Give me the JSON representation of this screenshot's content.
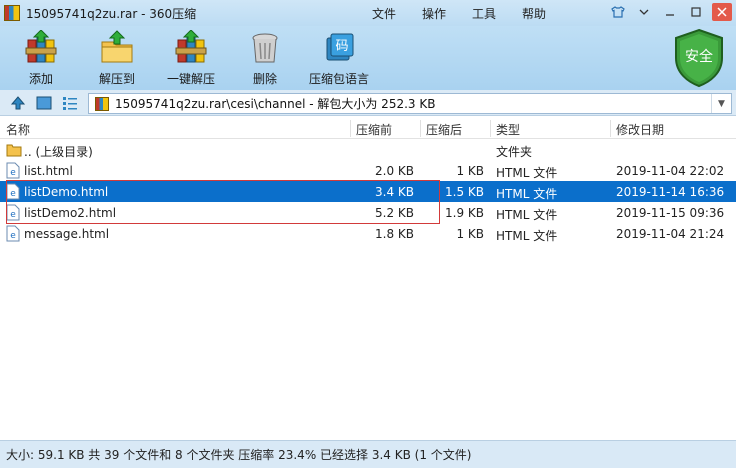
{
  "window": {
    "title": "15095741q2zu.rar - 360压缩",
    "menus": [
      "文件",
      "操作",
      "工具",
      "帮助"
    ]
  },
  "toolbar": {
    "buttons": [
      {
        "label": "添加",
        "icon": "add-books-icon"
      },
      {
        "label": "解压到",
        "icon": "extract-to-icon"
      },
      {
        "label": "一键解压",
        "icon": "one-click-extract-icon"
      },
      {
        "label": "删除",
        "icon": "trash-icon"
      },
      {
        "label": "压缩包语言",
        "icon": "archive-language-icon"
      }
    ],
    "security_badge": "安全",
    "language_icon_glyph": "码"
  },
  "address": {
    "path": "15095741q2zu.rar\\cesi\\channel - 解包大小为 252.3 KB"
  },
  "columns": {
    "name": "名称",
    "compressed_before": "压缩前",
    "compressed_after": "压缩后",
    "type": "类型",
    "modified": "修改日期"
  },
  "files": [
    {
      "name": ".. (上级目录)",
      "size": "",
      "packed": "",
      "type": "文件夹",
      "date": "",
      "kind": "folder",
      "selected": false
    },
    {
      "name": "list.html",
      "size": "2.0 KB",
      "packed": "1 KB",
      "type": "HTML 文件",
      "date": "2019-11-04 22:02",
      "kind": "html",
      "selected": false
    },
    {
      "name": "listDemo.html",
      "size": "3.4 KB",
      "packed": "1.5 KB",
      "type": "HTML 文件",
      "date": "2019-11-14 16:36",
      "kind": "html",
      "selected": true
    },
    {
      "name": "listDemo2.html",
      "size": "5.2 KB",
      "packed": "1.9 KB",
      "type": "HTML 文件",
      "date": "2019-11-15 09:36",
      "kind": "html",
      "selected": false
    },
    {
      "name": "message.html",
      "size": "1.8 KB",
      "packed": "1 KB",
      "type": "HTML 文件",
      "date": "2019-11-04 21:24",
      "kind": "html",
      "selected": false
    }
  ],
  "status": "大小: 59.1 KB 共 39 个文件和 8 个文件夹 压缩率 23.4% 已经选择 3.4 KB (1 个文件)",
  "colors": {
    "selection": "#0b6fcb",
    "highlight_box": "#d23a3a",
    "toolbar_bg": "#b5d8f2",
    "shield_green": "#3a9a3a"
  }
}
